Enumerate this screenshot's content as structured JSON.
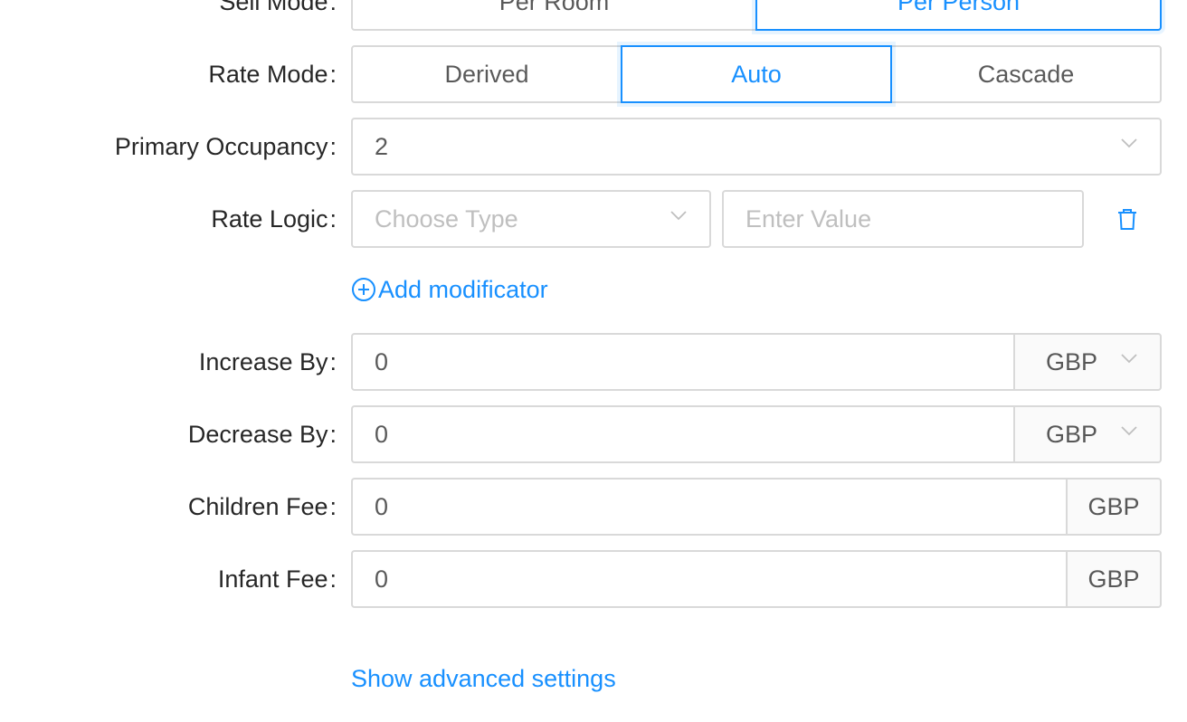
{
  "sell_mode": {
    "label": "Sell Mode",
    "options": [
      "Per Room",
      "Per Person"
    ],
    "selected": "Per Person"
  },
  "rate_mode": {
    "label": "Rate Mode",
    "options": [
      "Derived",
      "Auto",
      "Cascade"
    ],
    "selected": "Auto"
  },
  "primary_occupancy": {
    "label": "Primary Occupancy",
    "value": "2"
  },
  "rate_logic": {
    "label": "Rate Logic",
    "type_placeholder": "Choose Type",
    "value_placeholder": "Enter Value"
  },
  "add_modificator": {
    "label": "Add modificator"
  },
  "increase_by": {
    "label": "Increase By",
    "value": "0",
    "currency": "GBP"
  },
  "decrease_by": {
    "label": "Decrease By",
    "value": "0",
    "currency": "GBP"
  },
  "children_fee": {
    "label": "Children Fee",
    "value": "0",
    "currency": "GBP"
  },
  "infant_fee": {
    "label": "Infant Fee",
    "value": "0",
    "currency": "GBP"
  },
  "advanced": {
    "label": "Show advanced settings"
  },
  "colon": ":",
  "colors": {
    "accent": "#1890ff",
    "border": "#d9d9d9",
    "placeholder": "#bfbfbf",
    "addon_bg": "#fafafa"
  }
}
